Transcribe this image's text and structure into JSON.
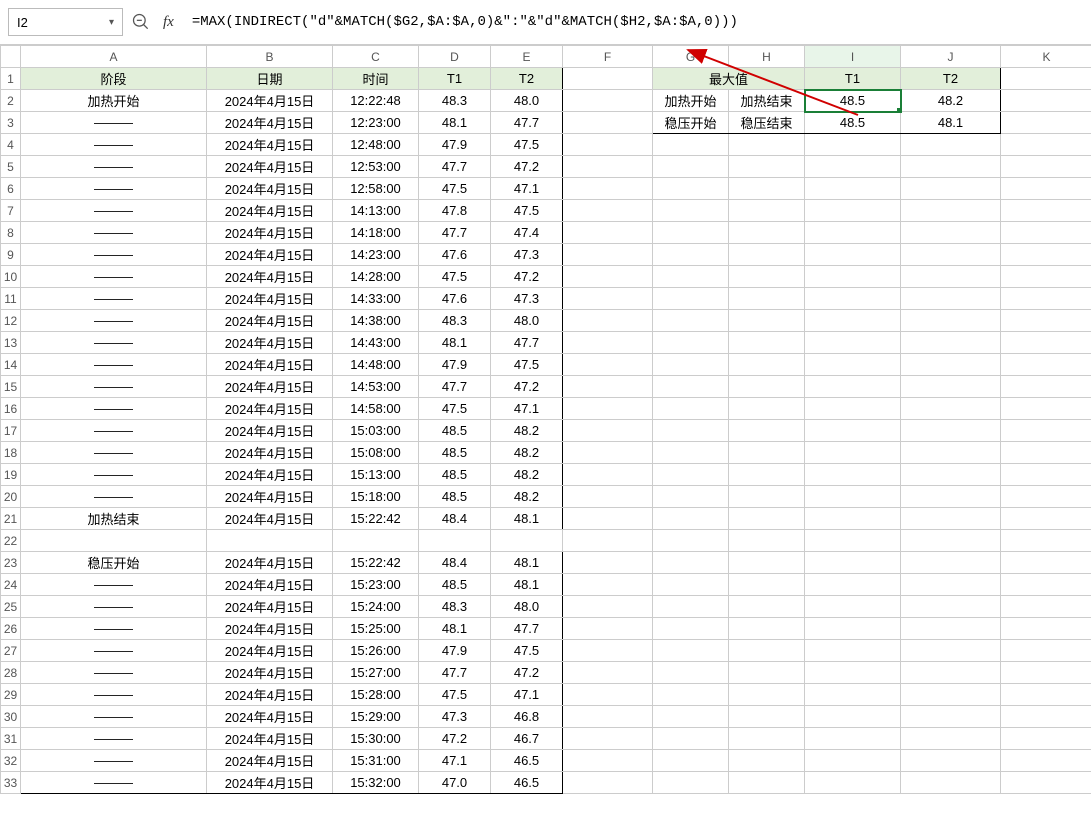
{
  "namebox": "I2",
  "fx_label": "fx",
  "formula": "=MAX(INDIRECT(\"d\"&MATCH($G2,$A:$A,0)&\":\"&\"d\"&MATCH($H2,$A:$A,0)))",
  "col_headers": [
    "A",
    "B",
    "C",
    "D",
    "E",
    "F",
    "G",
    "H",
    "I",
    "J",
    "K"
  ],
  "main_header": [
    "阶段",
    "日期",
    "时间",
    "T1",
    "T2"
  ],
  "side_header_title": "最大值",
  "side_header_cols": [
    "T1",
    "T2"
  ],
  "side_rows": [
    [
      "加热开始",
      "加热结束",
      "48.5",
      "48.2"
    ],
    [
      "稳压开始",
      "稳压结束",
      "48.5",
      "48.1"
    ]
  ],
  "rows": [
    [
      "加热开始",
      "2024年4月15日",
      "12:22:48",
      "48.3",
      "48.0"
    ],
    [
      "———",
      "2024年4月15日",
      "12:23:00",
      "48.1",
      "47.7"
    ],
    [
      "———",
      "2024年4月15日",
      "12:48:00",
      "47.9",
      "47.5"
    ],
    [
      "———",
      "2024年4月15日",
      "12:53:00",
      "47.7",
      "47.2"
    ],
    [
      "———",
      "2024年4月15日",
      "12:58:00",
      "47.5",
      "47.1"
    ],
    [
      "———",
      "2024年4月15日",
      "14:13:00",
      "47.8",
      "47.5"
    ],
    [
      "———",
      "2024年4月15日",
      "14:18:00",
      "47.7",
      "47.4"
    ],
    [
      "———",
      "2024年4月15日",
      "14:23:00",
      "47.6",
      "47.3"
    ],
    [
      "———",
      "2024年4月15日",
      "14:28:00",
      "47.5",
      "47.2"
    ],
    [
      "———",
      "2024年4月15日",
      "14:33:00",
      "47.6",
      "47.3"
    ],
    [
      "———",
      "2024年4月15日",
      "14:38:00",
      "48.3",
      "48.0"
    ],
    [
      "———",
      "2024年4月15日",
      "14:43:00",
      "48.1",
      "47.7"
    ],
    [
      "———",
      "2024年4月15日",
      "14:48:00",
      "47.9",
      "47.5"
    ],
    [
      "———",
      "2024年4月15日",
      "14:53:00",
      "47.7",
      "47.2"
    ],
    [
      "———",
      "2024年4月15日",
      "14:58:00",
      "47.5",
      "47.1"
    ],
    [
      "———",
      "2024年4月15日",
      "15:03:00",
      "48.5",
      "48.2"
    ],
    [
      "———",
      "2024年4月15日",
      "15:08:00",
      "48.5",
      "48.2"
    ],
    [
      "———",
      "2024年4月15日",
      "15:13:00",
      "48.5",
      "48.2"
    ],
    [
      "———",
      "2024年4月15日",
      "15:18:00",
      "48.5",
      "48.2"
    ],
    [
      "加热结束",
      "2024年4月15日",
      "15:22:42",
      "48.4",
      "48.1"
    ],
    [
      "",
      "",
      "",
      "",
      ""
    ],
    [
      "稳压开始",
      "2024年4月15日",
      "15:22:42",
      "48.4",
      "48.1"
    ],
    [
      "———",
      "2024年4月15日",
      "15:23:00",
      "48.5",
      "48.1"
    ],
    [
      "———",
      "2024年4月15日",
      "15:24:00",
      "48.3",
      "48.0"
    ],
    [
      "———",
      "2024年4月15日",
      "15:25:00",
      "48.1",
      "47.7"
    ],
    [
      "———",
      "2024年4月15日",
      "15:26:00",
      "47.9",
      "47.5"
    ],
    [
      "———",
      "2024年4月15日",
      "15:27:00",
      "47.7",
      "47.2"
    ],
    [
      "———",
      "2024年4月15日",
      "15:28:00",
      "47.5",
      "47.1"
    ],
    [
      "———",
      "2024年4月15日",
      "15:29:00",
      "47.3",
      "46.8"
    ],
    [
      "———",
      "2024年4月15日",
      "15:30:00",
      "47.2",
      "46.7"
    ],
    [
      "———",
      "2024年4月15日",
      "15:31:00",
      "47.1",
      "46.5"
    ],
    [
      "———",
      "2024年4月15日",
      "15:32:00",
      "47.0",
      "46.5"
    ]
  ]
}
